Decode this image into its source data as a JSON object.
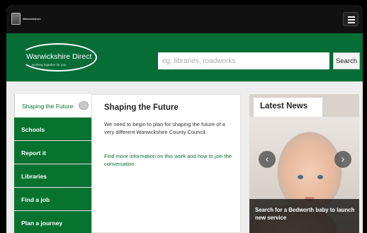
{
  "topbar": {
    "logo_text": "Warwickshire",
    "menu_icon": "hamburger-icon"
  },
  "header": {
    "brand_name": "Warwickshire Direct",
    "brand_tagline": "working together for you",
    "search_placeholder": "eg: libraries, roadworks",
    "search_button": "Search",
    "colors": {
      "green": "#066d36"
    }
  },
  "sidebar": {
    "items": [
      {
        "label": "Shaping the Future"
      },
      {
        "label": "Schools"
      },
      {
        "label": "Report it"
      },
      {
        "label": "Libraries"
      },
      {
        "label": "Find a job"
      },
      {
        "label": "Plan a journey"
      }
    ]
  },
  "main": {
    "title": "Shaping the Future",
    "paragraph": "We need to begin to plan for shaping the future of a very different Warwickshire County Council.",
    "link_text": "Find more information on this work and how to join the conversation."
  },
  "news": {
    "title": "Latest News",
    "caption": "Search for a Bedworth baby to launch new service",
    "prev_icon": "chevron-left-icon",
    "next_icon": "chevron-right-icon"
  }
}
